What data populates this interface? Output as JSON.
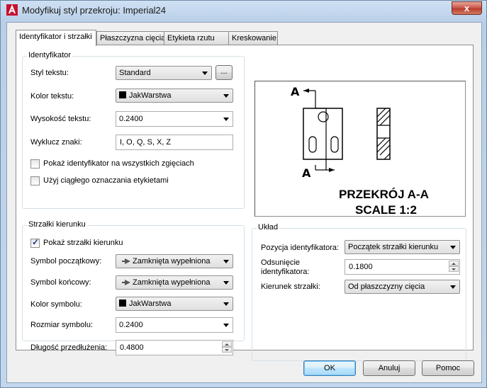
{
  "window": {
    "title": "Modyfikuj styl przekroju: Imperial24",
    "close_label": "x"
  },
  "tabs": [
    {
      "label": "Identyfikator i strzałki",
      "active": true
    },
    {
      "label": "Płaszczyzna cięcia",
      "active": false
    },
    {
      "label": "Etykieta rzutu",
      "active": false
    },
    {
      "label": "Kreskowanie",
      "active": false
    }
  ],
  "identifier": {
    "group_title": "Identyfikator",
    "text_style_label": "Styl tekstu:",
    "text_style_value": "Standard",
    "browse_label": "...",
    "text_color_label": "Kolor tekstu:",
    "text_color_value": "JakWarstwa",
    "text_height_label": "Wysokość tekstu:",
    "text_height_value": "0.2400",
    "exclude_label": "Wyklucz znaki:",
    "exclude_value": "I, O, Q, S, X, Z",
    "show_all_bends_label": "Pokaż identyfikator na wszystkich zgięciach",
    "show_all_bends_checked": false,
    "continuous_label": "Użyj ciągłego oznaczania etykietami",
    "continuous_checked": false
  },
  "arrows": {
    "group_title": "Strzałki kierunku",
    "show_label": "Pokaż strzałki kierunku",
    "show_checked": true,
    "start_symbol_label": "Symbol początkowy:",
    "start_symbol_value": "Zamknięta wypełniona",
    "end_symbol_label": "Symbol końcowy:",
    "end_symbol_value": "Zamknięta wypełniona",
    "symbol_color_label": "Kolor symbolu:",
    "symbol_color_value": "JakWarstwa",
    "symbol_size_label": "Rozmiar symbolu:",
    "symbol_size_value": "0.2400",
    "extension_label": "Długość przedłużenia:",
    "extension_value": "0.4800"
  },
  "layout": {
    "group_title": "Układ",
    "position_label": "Pozycja identyfikatora:",
    "position_value": "Początek strzałki kierunku",
    "offset_label_line1": "Odsunięcie",
    "offset_label_line2": "identyfikatora:",
    "offset_value": "0.1800",
    "direction_label": "Kierunek strzałki:",
    "direction_value": "Od płaszczyzny cięcia"
  },
  "preview": {
    "letter_top": "A",
    "letter_bottom": "A",
    "title_line1": "PRZEKRÓJ A-A",
    "title_line2": "SCALE 1:2"
  },
  "buttons": {
    "ok": "OK",
    "cancel": "Anuluj",
    "help": "Pomoc"
  }
}
